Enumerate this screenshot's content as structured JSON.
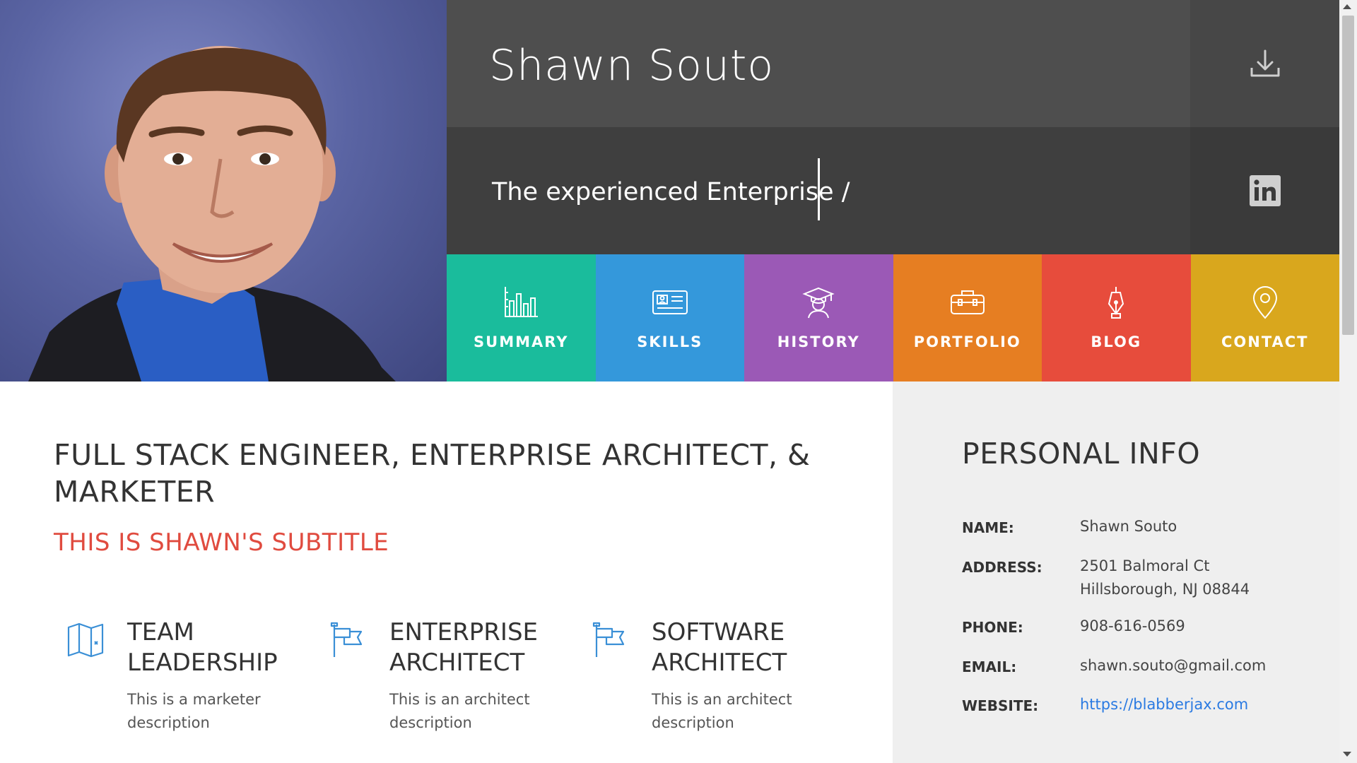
{
  "header": {
    "name": "Shawn Souto",
    "tagline": "The experienced  Enterprise /"
  },
  "icons": {
    "download": "download-icon",
    "linkedin": "linkedin-icon"
  },
  "nav": [
    {
      "label": "SUMMARY",
      "color": "#1abc9c",
      "icon": "bar-chart-icon"
    },
    {
      "label": "SKILLS",
      "color": "#3498db",
      "icon": "id-card-icon"
    },
    {
      "label": "HISTORY",
      "color": "#9b59b6",
      "icon": "graduate-icon"
    },
    {
      "label": "PORTFOLIO",
      "color": "#e67e22",
      "icon": "briefcase-icon"
    },
    {
      "label": "BLOG",
      "color": "#e74c3c",
      "icon": "pen-nib-icon"
    },
    {
      "label": "CONTACT",
      "color": "#d9a71d",
      "icon": "map-pin-icon"
    }
  ],
  "main": {
    "title": "FULL STACK ENGINEER, ENTERPRISE ARCHITECT, & MARKETER",
    "subtitle": "THIS IS SHAWN'S SUBTITLE",
    "features": [
      {
        "title": "TEAM LEADERSHIP",
        "description": "This is a marketer description",
        "icon": "map-icon"
      },
      {
        "title": "ENTERPRISE ARCHITECT",
        "description": "This is an architect description",
        "icon": "flag-icon"
      },
      {
        "title": "SOFTWARE ARCHITECT",
        "description": "This is an architect description",
        "icon": "flag-icon"
      }
    ]
  },
  "personal_info": {
    "title": "PERSONAL INFO",
    "rows": [
      {
        "label": "NAME:",
        "value": "Shawn Souto"
      },
      {
        "label": "ADDRESS:",
        "value": "2501 Balmoral Ct",
        "value2": "Hillsborough, NJ 08844"
      },
      {
        "label": "PHONE:",
        "value": "908-616-0569"
      },
      {
        "label": "EMAIL:",
        "value": "shawn.souto@gmail.com"
      },
      {
        "label": "WEBSITE:",
        "value": "https://blabberjax.com"
      }
    ]
  },
  "colors": {
    "accent_red": "#e04b3f",
    "link": "#2a7ae2",
    "accent_blue": "#3a8fd6"
  }
}
